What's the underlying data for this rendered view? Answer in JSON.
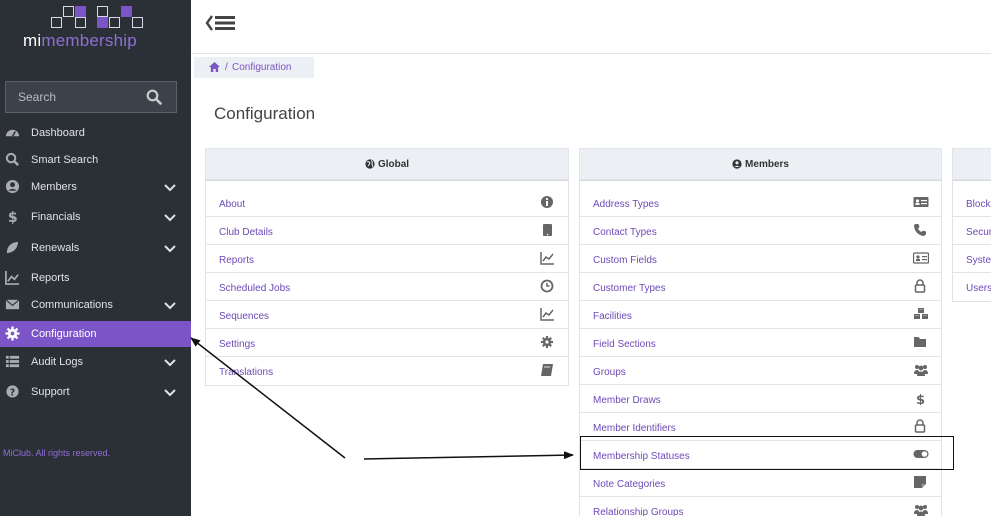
{
  "app": {
    "logo_mi": "mi",
    "logo_rest": "membership",
    "search_placeholder": "Search",
    "copyright": "MiClub. All rights reserved.",
    "accent_color": "#7b55c7",
    "sidebar_color": "#2b3036"
  },
  "sidebar": {
    "items": [
      {
        "label": "Dashboard",
        "icon": "dashboard-icon",
        "expandable": false
      },
      {
        "label": "Smart Search",
        "icon": "search-icon",
        "expandable": false
      },
      {
        "label": "Members",
        "icon": "user-circle-icon",
        "expandable": true
      },
      {
        "label": "Financials",
        "icon": "dollar-icon",
        "expandable": true
      },
      {
        "label": "Renewals",
        "icon": "leaf-icon",
        "expandable": true
      },
      {
        "label": "Reports",
        "icon": "line-chart-icon",
        "expandable": false
      },
      {
        "label": "Communications",
        "icon": "envelope-icon",
        "expandable": true
      },
      {
        "label": "Configuration",
        "icon": "gear-icon",
        "expandable": false,
        "active": true
      },
      {
        "label": "Audit Logs",
        "icon": "list-icon",
        "expandable": true
      },
      {
        "label": "Support",
        "icon": "question-icon",
        "expandable": true
      }
    ]
  },
  "breadcrumb": {
    "separator": "/",
    "current": "Configuration"
  },
  "page": {
    "title": "Configuration"
  },
  "panels": {
    "global": {
      "title": "Global",
      "items": [
        {
          "label": "About",
          "icon": "info-circle-icon"
        },
        {
          "label": "Club Details",
          "icon": "tablet-icon"
        },
        {
          "label": "Reports",
          "icon": "line-chart-icon"
        },
        {
          "label": "Scheduled Jobs",
          "icon": "clock-icon"
        },
        {
          "label": "Sequences",
          "icon": "line-chart-icon"
        },
        {
          "label": "Settings",
          "icon": "gear-icon"
        },
        {
          "label": "Translations",
          "icon": "book-icon"
        }
      ]
    },
    "members": {
      "title": "Members",
      "items": [
        {
          "label": "Address Types",
          "icon": "address-card-icon"
        },
        {
          "label": "Contact Types",
          "icon": "phone-icon"
        },
        {
          "label": "Custom Fields",
          "icon": "id-card-icon"
        },
        {
          "label": "Customer Types",
          "icon": "lock-icon"
        },
        {
          "label": "Facilities",
          "icon": "cubes-icon"
        },
        {
          "label": "Field Sections",
          "icon": "folder-icon"
        },
        {
          "label": "Groups",
          "icon": "users-icon"
        },
        {
          "label": "Member Draws",
          "icon": "dollar-icon"
        },
        {
          "label": "Member Identifiers",
          "icon": "lock-icon"
        },
        {
          "label": "Membership Statuses",
          "icon": "toggle-on-icon"
        },
        {
          "label": "Note Categories",
          "icon": "sticky-note-icon"
        },
        {
          "label": "Relationship Groups",
          "icon": "users-icon"
        }
      ]
    },
    "third": {
      "items": [
        {
          "label": "Block"
        },
        {
          "label": "Secur"
        },
        {
          "label": "Syste"
        },
        {
          "label": "Users"
        }
      ]
    }
  }
}
